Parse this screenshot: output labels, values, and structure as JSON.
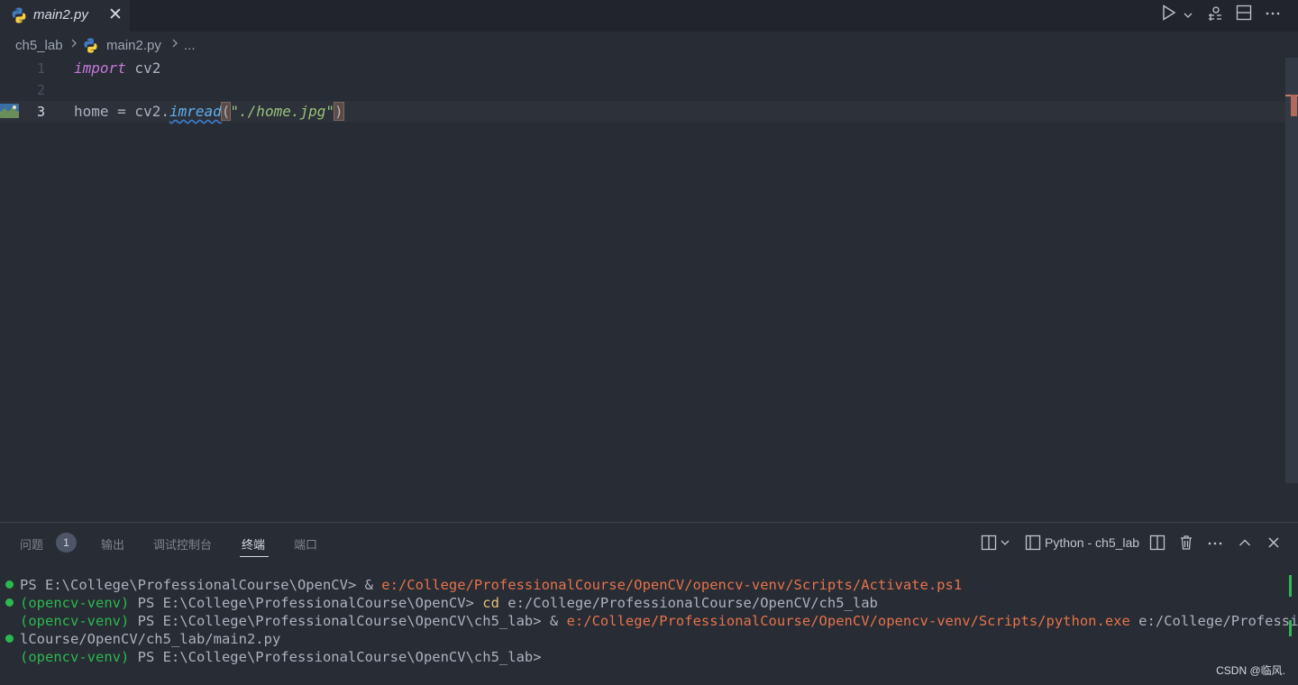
{
  "tab": {
    "filename": "main2.py",
    "close": "✕"
  },
  "breadcrumb": {
    "folder": "ch5_lab",
    "file": "main2.py",
    "more": "..."
  },
  "editor": {
    "lines": [
      {
        "num": "1",
        "kw": "import",
        "rest": " cv2"
      },
      {
        "num": "2"
      },
      {
        "num": "3",
        "var": "home = cv2.",
        "fn": "imread",
        "open": "(",
        "str": "\"./home.jpg\"",
        "close": ")"
      }
    ]
  },
  "panel": {
    "tabs": [
      "问题",
      "输出",
      "调试控制台",
      "终端",
      "端口"
    ],
    "problems_count": "1",
    "terminal_name": "Python - ch5_lab"
  },
  "terminal": {
    "l1_ps": "PS E:\\College\\ProfessionalCourse\\OpenCV> & ",
    "l1_path": "e:/College/ProfessionalCourse/OpenCV/opencv-venv/Scripts/Activate.ps1",
    "l2_venv": "(opencv-venv)",
    "l2_ps": " PS E:\\College\\ProfessionalCourse\\OpenCV> ",
    "l2_cmd": "cd",
    "l2_arg": " e:/College/ProfessionalCourse/OpenCV/ch5_lab",
    "l3_venv": "(opencv-venv)",
    "l3_ps": " PS E:\\College\\ProfessionalCourse\\OpenCV\\ch5_lab> & ",
    "l3_path": "e:/College/ProfessionalCourse/OpenCV/opencv-venv/Scripts/python.exe",
    "l3_arg": " e:/College/Professiona",
    "l4": "lCourse/OpenCV/ch5_lab/main2.py",
    "l5_venv": "(opencv-venv)",
    "l5_ps": " PS E:\\College\\ProfessionalCourse\\OpenCV\\ch5_lab>"
  },
  "watermark": "CSDN @临风."
}
